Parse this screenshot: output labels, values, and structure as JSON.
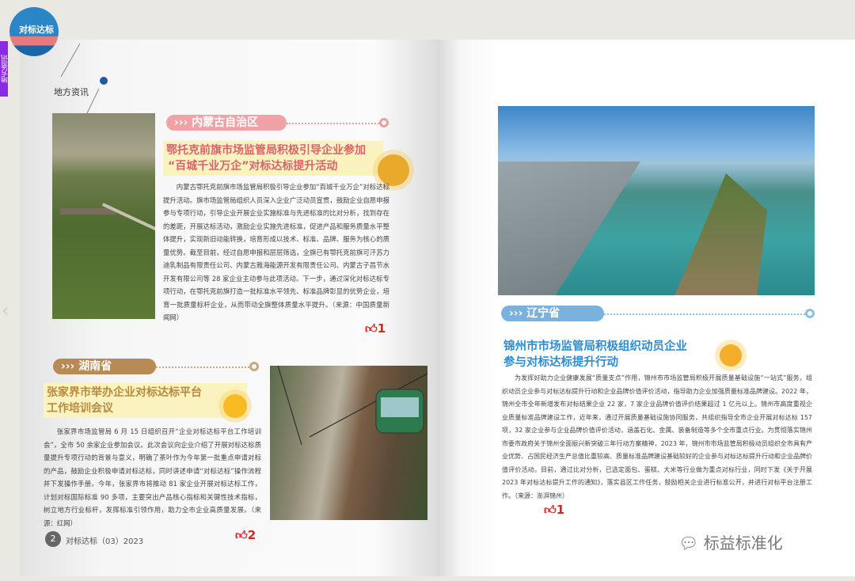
{
  "header": {
    "logo_text": "对标达标",
    "side_tab": "地方资讯",
    "section": "地方资讯"
  },
  "articles": [
    {
      "region": "内蒙古自治区",
      "title_l1": "鄂托克前旗市场监管局积极引导企业参加",
      "title_l2": "“百城千业万企”对标达标提升活动",
      "body": "内蒙古鄂托克前旗市场监管局积极引导企业参加“百城千业万企”对标达标提升活动。旗市场监管局组织人员深入企业广泛动员宣贯，鼓励企业自愿申报参与专项行动，引导企业开展企业实施标准与先进标准的比对分析，找到存在的差距，开展达标活动，激励企业实施先进标准，促进产品和服务质量水平整体提升，实现新旧动能转换，培育形成以技术、标准、品牌、服务为核心的质量优势。截至目前，经过自愿申报和层层筛选，全旗已有鄂托克前旗可汗苏力迪乳制品有限责任公司、内蒙古雅海能源开发有限责任公司、内蒙古子昌节水开发有限公司等 28 家企业主动参与此项活动。下一步，通过深化对标达标专项行动，在鄂托克前旗打造一批标准水平领先、标准品牌彰显的优势企业，培育一批质量标杆企业，从而带动全旗整体质量水平提升。（来源：中国质量新闻网）",
      "likes": "1"
    },
    {
      "region": "湖南省",
      "title_l1": "张家界市举办企业对标达标平台",
      "title_l2": "工作培训会议",
      "body": "张家界市场监管局 6 月 15 日组织召开“企业对标达标平台工作培训会”，全市 50 余家企业参加会议。此次会议向企业介绍了开展对标达标质量提升专项行动的背景与意义，明确了茶叶作为今年第一批重点申请对标的产品，鼓励企业积极申请对标达标，同时讲述申请“对标达标”操作流程并下发操作手册。今年，张家界市将推动 81 家企业开展对标达标工作，计划对标国际标准 90 多项，主要突出产品核心指标和关键性技术指标，树立地方行业标杆，发挥标准引领作用，助力全市企业高质量发展。（来源：红网）",
      "likes": "2"
    },
    {
      "region": "辽宁省",
      "title_l1": "锦州市市场监管局积极组织动员企业",
      "title_l2": "参与对标达标提升行动",
      "body": "为发挥好助力企业健康发展“质量支点”作用，锦州市市场监管局积极开展质量基础设施“一站式”服务，组织动员企业参与对标达标提升行动和企业品牌价值评价活动，指导助力企业加强质量标准品牌建设。2022 年，锦州全市全年新增发布对标结果企业 22 家，7 家企业品牌价值评价结果超过 1 亿元以上。锦州市高度重视企业质量标准品牌建设工作，近年来，通过开展质量基础设施协同服务，共组织指导全市企业开展对标达标 157 项，32 家企业参与企业品牌价值评价活动，涵盖石化、金属、装备制造等多个全市重点行业。为贯彻落实锦州市委市政府关于锦州全面振兴新突破三年行动方案精神，2023 年，锦州市市场监管局积极动员组织全市具有产业优势、占国民经济生产总值比重较高、质量标准品牌建设基础较好的企业参与对标达标提升行动和企业品牌价值评价活动。目前，通过比对分析，已选定面包、蛋糕、大米等行业做为重点对标行业，同时下发《关于开展 2023 年对标达标提升工作的通知》，落实县区工作任务，鼓励相关企业进行标准公开，并进行对标平台注册工作。（来源：澎湃锦州）",
      "likes": "1"
    }
  ],
  "footer": {
    "page_number": "2",
    "issue": "对标达标（03）2023",
    "watermark": "标益标准化"
  },
  "colors": {
    "pink": "#f0a3a6",
    "brown": "#b88a55",
    "blue": "#7bb2dc",
    "sun": "#f3ac1e"
  }
}
